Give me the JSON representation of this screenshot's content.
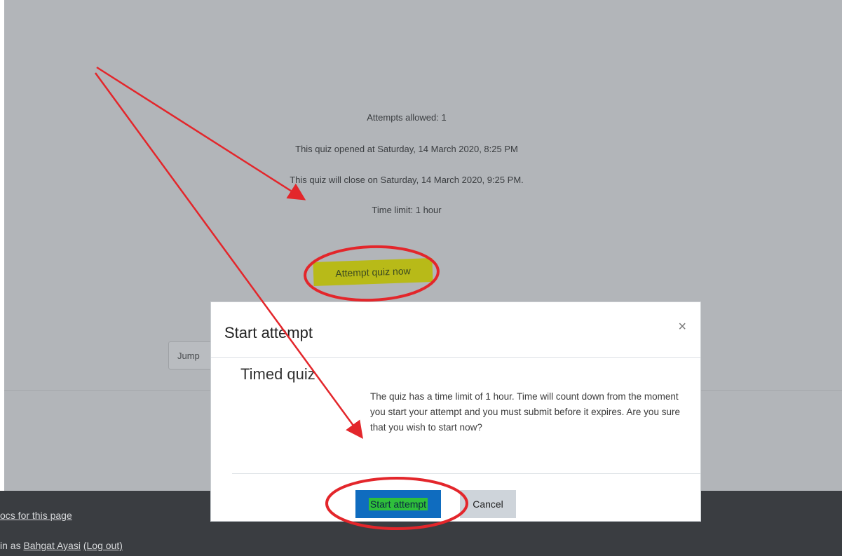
{
  "quiz_info": {
    "attempts": "Attempts allowed: 1",
    "opened": "This quiz opened at Saturday, 14 March 2020, 8:25 PM",
    "closes": "This quiz will close on Saturday, 14 March 2020, 9:25 PM.",
    "time_limit": "Time limit: 1 hour"
  },
  "attempt_button": "Attempt quiz now",
  "jump_to": "Jump",
  "footer": {
    "docs_link": "ocs for this page",
    "logged_prefix": "in as",
    "user_name": "Bahgat Ayasi",
    "logout": "(Log out)"
  },
  "modal": {
    "title": "Start attempt",
    "close": "×",
    "section_title": "Timed quiz",
    "body": "The quiz has a time limit of 1 hour. Time will count down from the moment you start your attempt and you must submit before it expires. Are you sure that you wish to start now?",
    "start_button": "Start attempt",
    "cancel_button": "Cancel"
  },
  "colors": {
    "annotation_red": "#e3262b",
    "highlight_yellow": "#b8ba18",
    "highlight_green": "#2fbf3b",
    "primary_blue": "#0f6cbf",
    "footer_dark": "#3a3d41",
    "dim_overlay": "#b2b5b9"
  }
}
